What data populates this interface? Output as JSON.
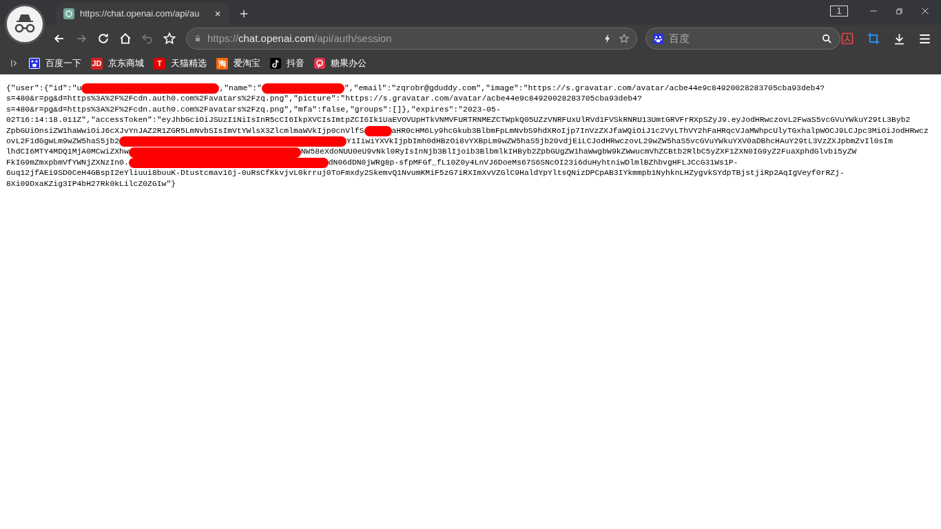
{
  "window": {
    "tab_count": "1"
  },
  "tabs": [
    {
      "title": "https://chat.openai.com/api/au",
      "selected": true
    }
  ],
  "toolbar": {
    "forward_disabled": true,
    "undo_disabled": true
  },
  "address_bar": {
    "scheme": "https://",
    "host": "chat.openai.com",
    "path": "/api/auth/session"
  },
  "search": {
    "placeholder": "百度"
  },
  "bookmarks": [
    {
      "kind": "baidu",
      "label": "百度一下"
    },
    {
      "kind": "jd",
      "icon_text": "JD",
      "label": "京东商城"
    },
    {
      "kind": "tmall",
      "icon_text": "T",
      "label": "天猫精选"
    },
    {
      "kind": "taobao",
      "icon_text": "淘",
      "label": "爱淘宝"
    },
    {
      "kind": "douyin",
      "label": "抖音"
    },
    {
      "kind": "tangguo",
      "label": "糖果办公"
    }
  ],
  "content": {
    "lines": [
      [
        {
          "kind": "text",
          "text": "{\"user\":{\"id\":\"u"
        },
        {
          "kind": "redaction"
        },
        {
          "kind": "text",
          "text": ",\"name\":\""
        },
        {
          "kind": "redaction"
        },
        {
          "kind": "text",
          "text": "\",\"email\":\"zqrobr@gduddy.com\",\"image\":\"https://s.gravatar.com/avatar/acbe44e9c84920028283705cba93deb4?"
        }
      ],
      [
        {
          "kind": "text",
          "text": "s=480&r=pg&d=https%3A%2F%2Fcdn.auth0.com%2Favatars%2Fzq.png\",\"picture\":\"https://s.gravatar.com/avatar/acbe44e9c84920028283705cba93deb4?"
        }
      ],
      [
        {
          "kind": "text",
          "text": "s=480&r=pg&d=https%3A%2F%2Fcdn.auth0.com%2Favatars%2Fzq.png\",\"mfa\":false,\"groups\":[]},\"expires\":\"2023-05-"
        }
      ],
      [
        {
          "kind": "text",
          "text": "02T16:14:18.011Z\",\"accessToken\":\"eyJhbGciOiJSUzI1NiIsInR5cCI6IkpXVCIsImtpZCI6Ik1UaEVOVUpHTkVNMVFURTRNMEZCTWpkQ05UZzVNRFUxUlRVd1FVSkRNRU13UmtGRVFrRXpSZyJ9.eyJodHRwczovL2FwaS5vcGVuYWkuY29tL3Byb2"
        }
      ],
      [
        {
          "kind": "text",
          "text": "ZpbGUiOnsiZW1haWwiOiJ6cXJvYnJAZ2R1ZGR5LmNvbSIsImVtYWlsX3ZlcmlmaWVkIjp0cnVlfS"
        },
        {
          "kind": "redaction"
        },
        {
          "kind": "text",
          "text": "aHR0cHM6Ly9hcGkub3BlbmFpLmNvbS9hdXRoIjp7InVzZXJfaWQiOiJ1c2VyLThVY2hFaHRqcVJaMWhpcUlyTGxhalpWOCJ9LCJpc3MiOiJodHRwcz"
        }
      ],
      [
        {
          "kind": "text",
          "text": "ovL2F1dGgwLm9wZW5haS5jb2"
        },
        {
          "kind": "redaction"
        },
        {
          "kind": "text",
          "text": "Y1IiwiYXVkIjpbImh0dHBzOi8vYXBpLm9wZW5haS5jb20vdjEiLCJodHRwczovL29wZW5haS5vcGVuYWkuYXV0aDBhcHAuY29tL3VzZXJpbmZvIl0sIm"
        }
      ],
      [
        {
          "kind": "text",
          "text": "lhdCI6MTY4MDQ1MjA0MCwiZXhw"
        },
        {
          "kind": "redaction"
        },
        {
          "kind": "text",
          "text": "NW58eXdoNUU0eU9vNkl0RyIsInNjb3BlIjoib3BlbmlkIHByb2ZpbGUgZW1haWwgbW9kZWwucmVhZCBtb2RlbC5yZXF1ZXN0IG9yZ2FuaXphdGlvbi5yZW"
        }
      ],
      [
        {
          "kind": "text",
          "text": "FkIG9mZmxpbmVfYWNjZXNzIn0."
        },
        {
          "kind": "redaction"
        },
        {
          "kind": "text",
          "text": "dN06dDN0jWRg8p-sfpMFGf_fL10Z0y4LnVJ6DoeMs67S6SNcOI23i6duHyhtniwDlmlBZhbvgHFLJCcG31Ws1P-"
        }
      ],
      [
        {
          "kind": "text",
          "text": "6uq12jfAEi9SD0CeH4GBspI2eYliuui8buuK-Dtustcmav16j-0uRsCfKkvjvL0krruj0ToFmxdy2SkemvQ1NvumKMiF5zG7iRXImXvVZGlC9HaldYpYltsQNizDPCpAB3IYkmmpb1NyhknLHZygvkSYdpTBjstjiRp2AqIgVeyf0rRZj-"
        }
      ],
      [
        {
          "kind": "text",
          "text": "8Xi09DxaKZig3IP4bH27Rk0kLilcZ0ZGIw\"}"
        }
      ]
    ]
  }
}
